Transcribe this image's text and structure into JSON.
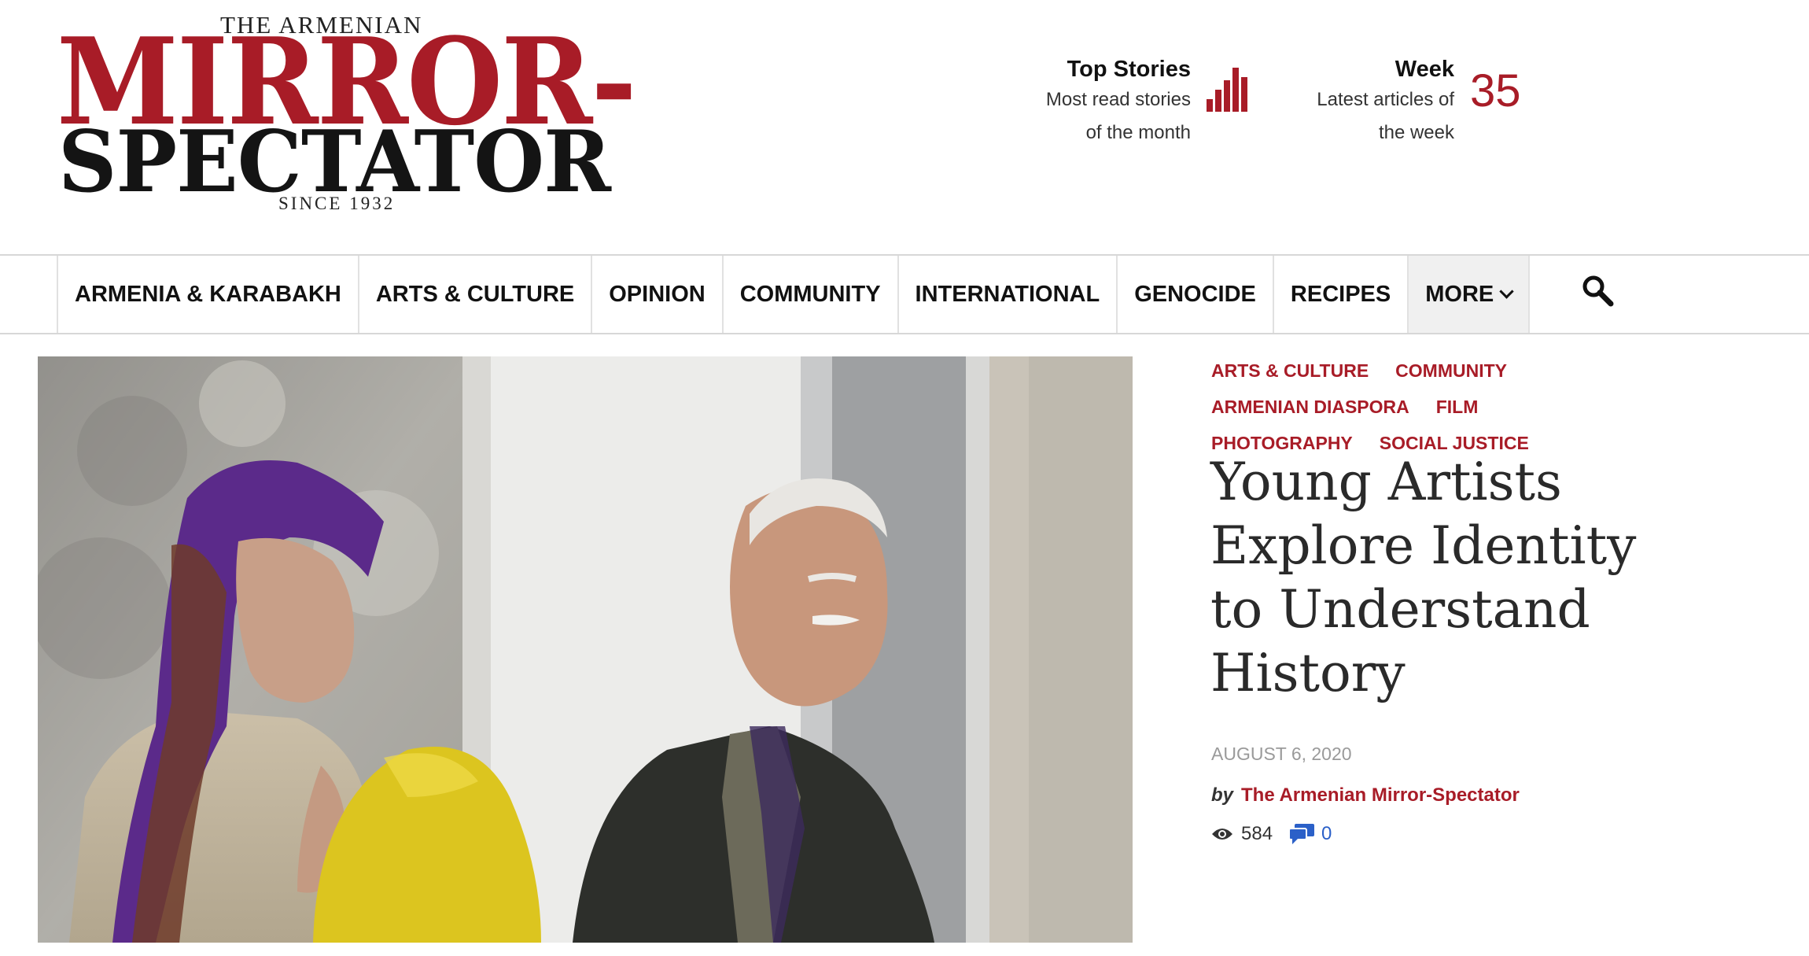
{
  "logo": {
    "line_top": "THE ARMENIAN",
    "line_main": "MIRROR-",
    "line_second": "SPECTATOR",
    "line_since": "SINCE 1932",
    "color_red": "#a81c27",
    "color_dark": "#141414"
  },
  "header": {
    "top_stories": {
      "title": "Top Stories",
      "desc_1": "Most read stories",
      "desc_2": "of the month",
      "icon": "bar-chart-icon"
    },
    "week": {
      "title": "Week",
      "desc_1": "Latest articles of",
      "desc_2": "the week",
      "count": "35"
    }
  },
  "nav": {
    "items": [
      {
        "label": "ARMENIA & KARABAKH"
      },
      {
        "label": "ARTS & CULTURE"
      },
      {
        "label": "OPINION"
      },
      {
        "label": "COMMUNITY"
      },
      {
        "label": "INTERNATIONAL"
      },
      {
        "label": "GENOCIDE"
      },
      {
        "label": "RECIPES"
      },
      {
        "label": "MORE"
      }
    ],
    "search_icon": "search-icon"
  },
  "article": {
    "tags": [
      "ARTS & CULTURE",
      "COMMUNITY",
      "ARMENIAN DIASPORA",
      "FILM",
      "PHOTOGRAPHY",
      "SOCIAL JUSTICE"
    ],
    "title": "Young Artists Explore Identity to Understand History",
    "date": "AUGUST 6, 2020",
    "by": "by",
    "author": "The Armenian Mirror-Spectator",
    "views": "584",
    "comments": "0",
    "accent_color": "#a81c27",
    "comment_color": "#2b60c8",
    "hero_image": "elderly-couple-photo"
  }
}
